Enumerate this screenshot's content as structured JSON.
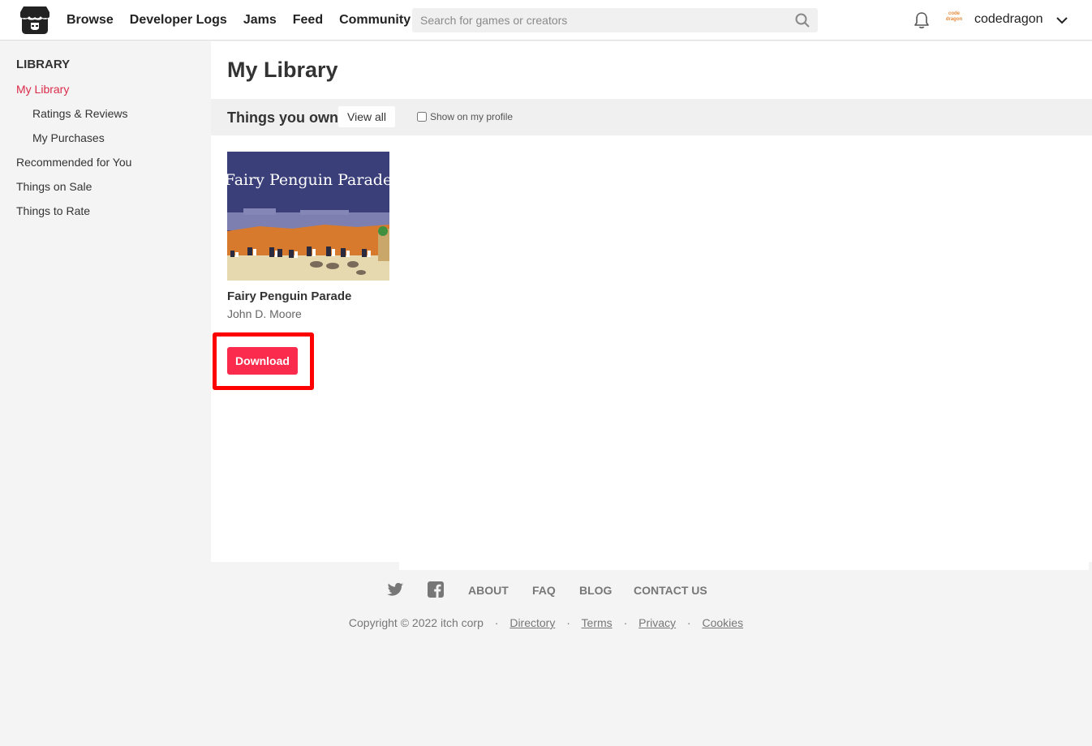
{
  "header": {
    "nav": [
      "Browse",
      "Developer Logs",
      "Jams",
      "Feed",
      "Community"
    ],
    "search_placeholder": "Search for games or creators",
    "avatar_text": "code dragon",
    "username": "codedragon"
  },
  "sidebar": {
    "heading": "LIBRARY",
    "items": [
      {
        "label": "My Library",
        "active": true
      },
      {
        "label": "Ratings & Reviews"
      },
      {
        "label": "My Purchases"
      },
      {
        "label": "Recommended for You"
      },
      {
        "label": "Things on Sale"
      },
      {
        "label": "Things to Rate"
      }
    ]
  },
  "main": {
    "title": "My Library",
    "section_title": "Things you own",
    "view_all": "View all",
    "show_on_profile": "Show on my profile",
    "game": {
      "thumbnail_text": "Fairy Penguin Parade",
      "title": "Fairy Penguin Parade",
      "author": "John D. Moore",
      "download_label": "Download"
    }
  },
  "footer": {
    "links": [
      "ABOUT",
      "FAQ",
      "BLOG",
      "CONTACT US"
    ],
    "copyright": "Copyright © 2022 itch corp",
    "legal": [
      "Directory",
      "Terms",
      "Privacy",
      "Cookies"
    ]
  },
  "colors": {
    "accent": "#da2c49",
    "download_button": "#fa2b4c",
    "highlight_box": "#ff0000"
  }
}
